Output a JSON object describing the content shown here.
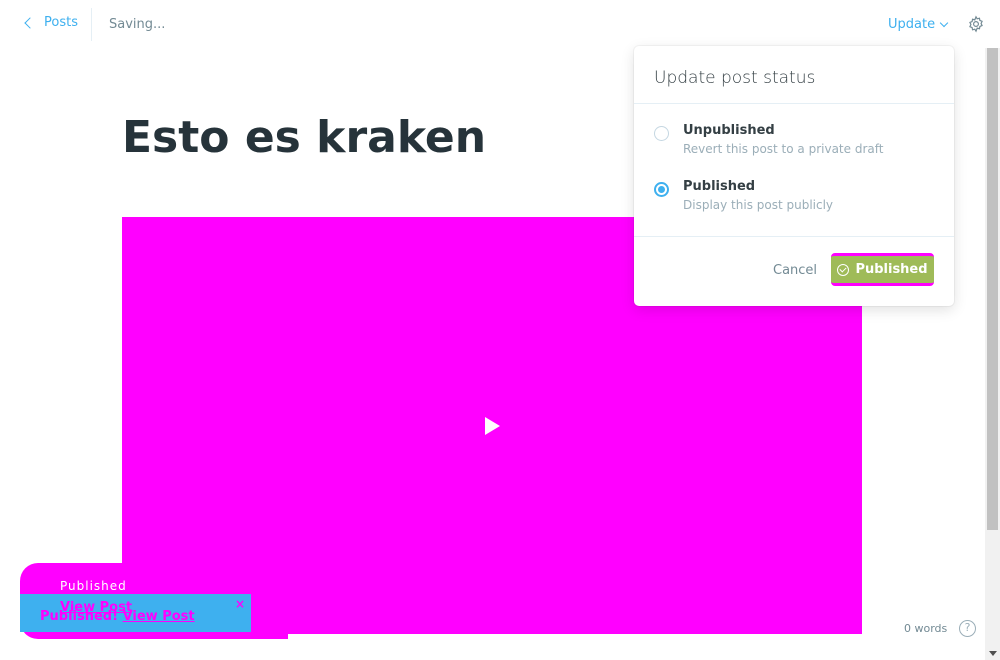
{
  "header": {
    "back_label": "Posts",
    "status": "Saving...",
    "update_label": "Update"
  },
  "editor": {
    "title": "Esto es kraken",
    "word_count": "0 words",
    "help_glyph": "?"
  },
  "popover": {
    "title": "Update post status",
    "options": [
      {
        "label": "Unpublished",
        "description": "Revert this post to a private draft",
        "selected": false
      },
      {
        "label": "Published",
        "description": "Display this post publicly",
        "selected": true
      }
    ],
    "cancel_label": "Cancel",
    "confirm_label": "Published"
  },
  "toast": {
    "ghost_text": "Published",
    "ghost_link": "View Post",
    "message": "Published!",
    "link": "View Post",
    "close_glyph": "×"
  },
  "colors": {
    "accent": "#3eb0ef",
    "publish_green": "#9fbb58",
    "placeholder_magenta": "#ff00ff"
  },
  "icons": [
    "chevron-left-icon",
    "chevron-down-icon",
    "gear-icon",
    "play-icon",
    "check-circle-icon",
    "help-icon",
    "close-icon"
  ]
}
